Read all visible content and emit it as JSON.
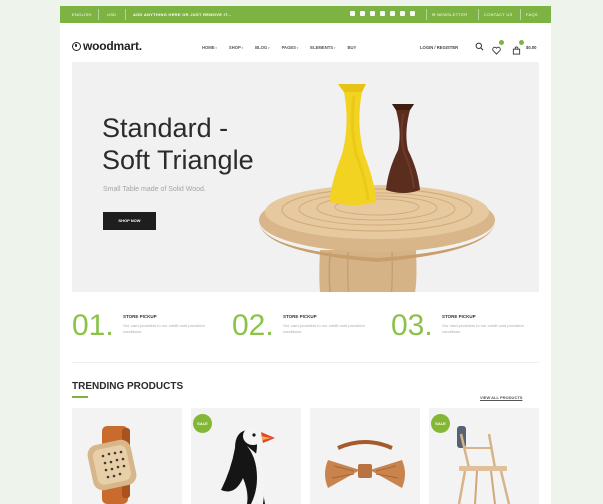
{
  "topbar": {
    "language": "English",
    "currency": "USD",
    "promo": "Add anything here or just remove it...",
    "newsletter": "Newsletter",
    "contact": "Contact us",
    "faqs": "FAQs"
  },
  "header": {
    "logo": "woodmart.",
    "nav": [
      "Home",
      "Shop",
      "Blog",
      "Pages",
      "Elements",
      "Buy"
    ],
    "login": "Login / Register",
    "cart_label": "$0.00"
  },
  "hero": {
    "title_line1": "Standard -",
    "title_line2": "Soft Triangle",
    "subtitle": "Small Table made of Solid Wood.",
    "button": "Shop Now"
  },
  "features": [
    {
      "num": "01.",
      "title": "Store Pickup",
      "desc": "Our card providers to our credit card providers conditions."
    },
    {
      "num": "02.",
      "title": "Store Pickup",
      "desc": "Our card providers to our credit card providers conditions."
    },
    {
      "num": "03.",
      "title": "Store Pickup",
      "desc": "Our card providers to our credit card providers conditions."
    }
  ],
  "trending": {
    "title": "Trending Products",
    "view_all": "View all products",
    "products": [
      {
        "name": "wooden-watch",
        "badge": ""
      },
      {
        "name": "puffin-figure",
        "badge": "Sale"
      },
      {
        "name": "wooden-bow-tie",
        "badge": ""
      },
      {
        "name": "wooden-chair",
        "badge": "Sale"
      }
    ]
  },
  "colors": {
    "accent": "#7cb342",
    "page_background": "#eef4ec",
    "dark": "#1e1e1e"
  }
}
